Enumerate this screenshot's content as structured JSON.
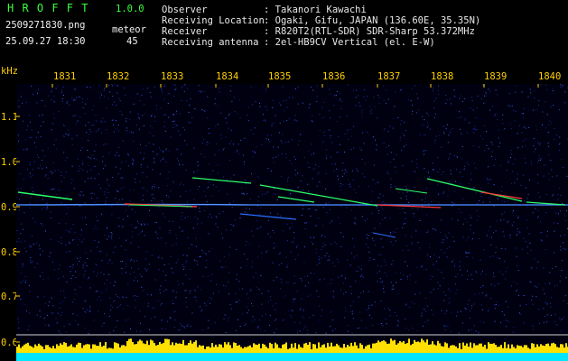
{
  "header": {
    "app_name": "H R O F F T",
    "version": "1.0.0",
    "filename": "2509271830.png",
    "mode_label": "meteor",
    "timestamp": "25.09.27 18:30",
    "count": "45",
    "fields": [
      {
        "label": "Observer",
        "value": ": Takanori Kawachi"
      },
      {
        "label": "Receiving Location",
        "value": ": Ogaki, Gifu, JAPAN (136.60E, 35.35N)"
      },
      {
        "label": "Receiver",
        "value": ": R820T2(RTL-SDR) SDR-Sharp 53.372MHz"
      },
      {
        "label": "Receiving antenna",
        "value": ": 2el-HB9CV Vertical (el. E-W)"
      }
    ]
  },
  "axes": {
    "y_unit": "kHz",
    "x_ticks": [
      "1831",
      "1832",
      "1833",
      "1834",
      "1835",
      "1836",
      "1837",
      "1838",
      "1839",
      "1840"
    ],
    "y_ticks": [
      "1.1",
      "1.0",
      "0.9",
      "0.8",
      "0.7",
      "0.6"
    ]
  },
  "colors": {
    "background": "#000000",
    "label_yellow": "#ffd000",
    "header_green": "#3cff3c",
    "noise_blue": "#1a2fa0",
    "echo_green": "#2cff6a",
    "echo_red": "#ff3a3a",
    "level_yellow": "#ffe000",
    "level_cyan": "#00e5ff"
  }
}
